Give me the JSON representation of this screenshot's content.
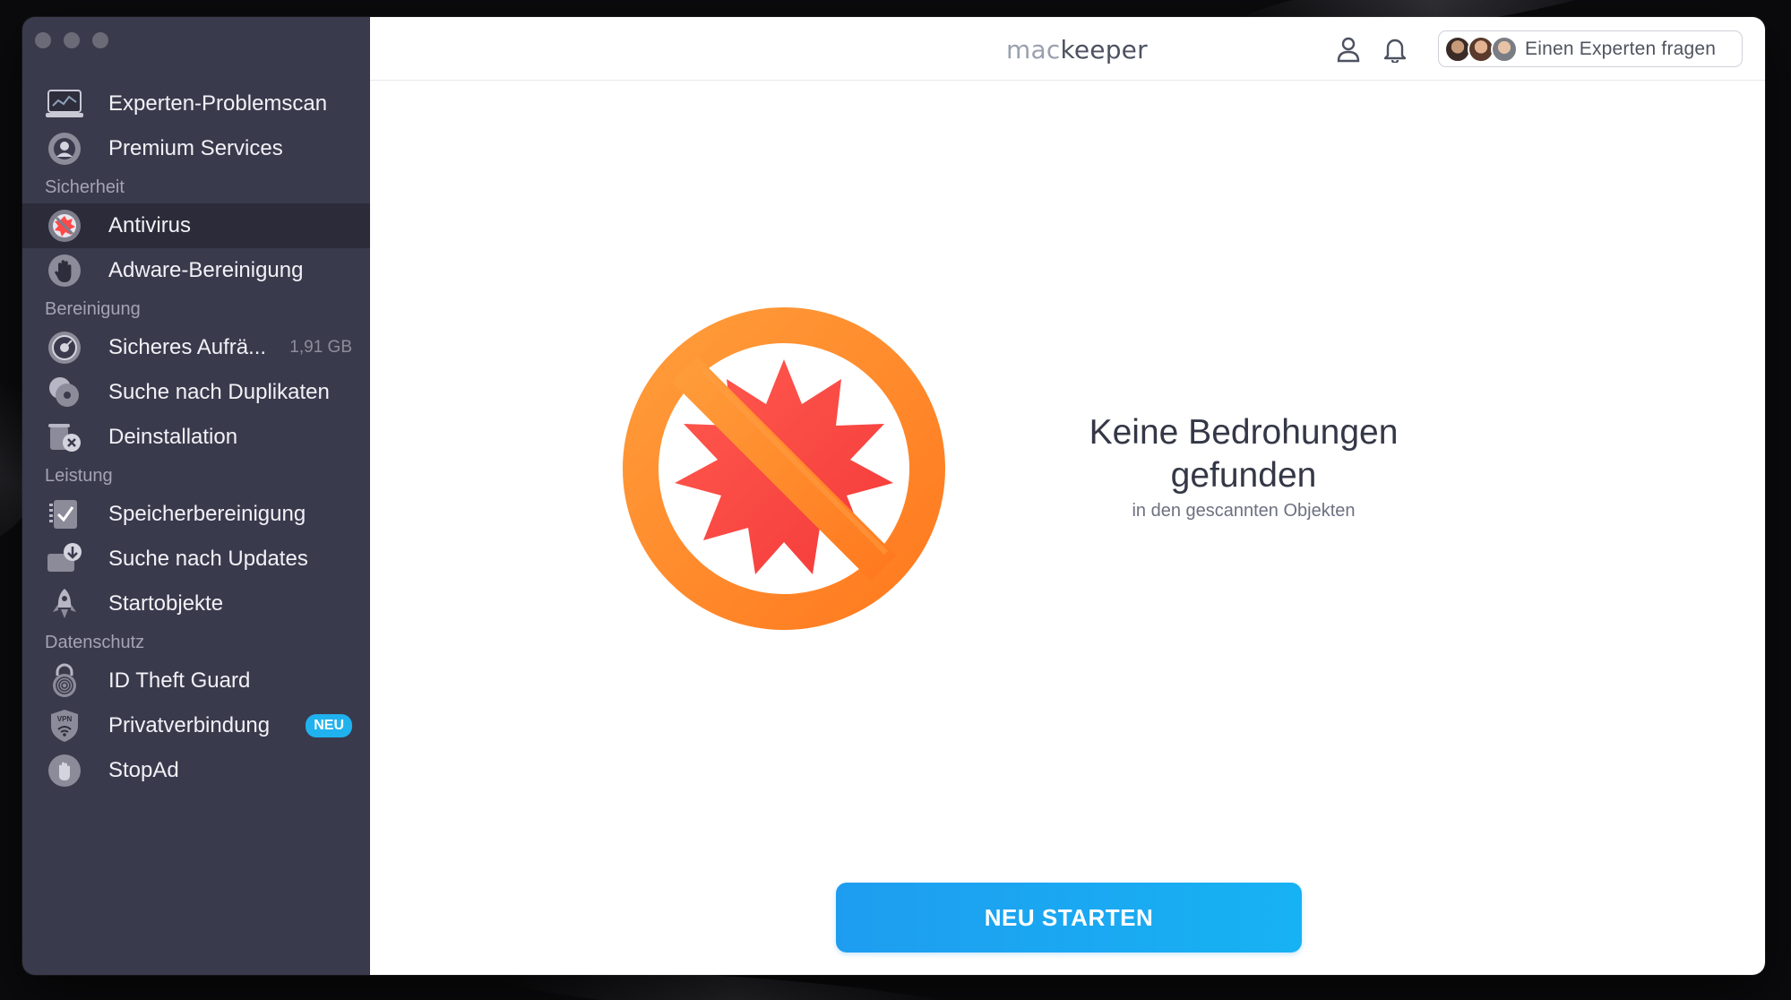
{
  "brand": {
    "mac": "mac",
    "keeper": "keeper"
  },
  "header": {
    "expert_button_label": "Einen Experten fragen"
  },
  "sidebar": {
    "top_items": [
      {
        "label": "Experten-Problemscan",
        "icon": "laptop-scan-icon"
      },
      {
        "label": "Premium Services",
        "icon": "premium-services-icon"
      }
    ],
    "sections": [
      {
        "title": "Sicherheit",
        "items": [
          {
            "label": "Antivirus",
            "icon": "antivirus-icon",
            "active": true
          },
          {
            "label": "Adware-Bereinigung",
            "icon": "hand-icon"
          }
        ]
      },
      {
        "title": "Bereinigung",
        "items": [
          {
            "label": "Sicheres Aufrä...",
            "icon": "safe-cleanup-icon",
            "meta": "1,91 GB"
          },
          {
            "label": "Suche nach Duplikaten",
            "icon": "duplicates-icon"
          },
          {
            "label": "Deinstallation",
            "icon": "uninstall-icon"
          }
        ]
      },
      {
        "title": "Leistung",
        "items": [
          {
            "label": "Speicherbereinigung",
            "icon": "memory-cleaner-icon"
          },
          {
            "label": "Suche nach Updates",
            "icon": "update-tracker-icon"
          },
          {
            "label": "Startobjekte",
            "icon": "rocket-icon"
          }
        ]
      },
      {
        "title": "Datenschutz",
        "items": [
          {
            "label": "ID Theft Guard",
            "icon": "fingerprint-lock-icon"
          },
          {
            "label": "Privatverbindung",
            "icon": "vpn-shield-icon",
            "badge": "NEU"
          },
          {
            "label": "StopAd",
            "icon": "stopad-hand-icon"
          }
        ]
      }
    ]
  },
  "result": {
    "title_line1": "Keine Bedrohungen",
    "title_line2": "gefunden",
    "subtitle": "in den gescannten Objekten",
    "hero_icon": "no-threat-icon"
  },
  "restart_button_label": "NEU STARTEN",
  "colors": {
    "sidebar_bg": "#3a3a4d",
    "active_item_bg": "#2b2b3a",
    "accent_blue": "#1fa3f1",
    "hero_orange": "#ff8a2a",
    "hero_red": "#ff4848"
  }
}
